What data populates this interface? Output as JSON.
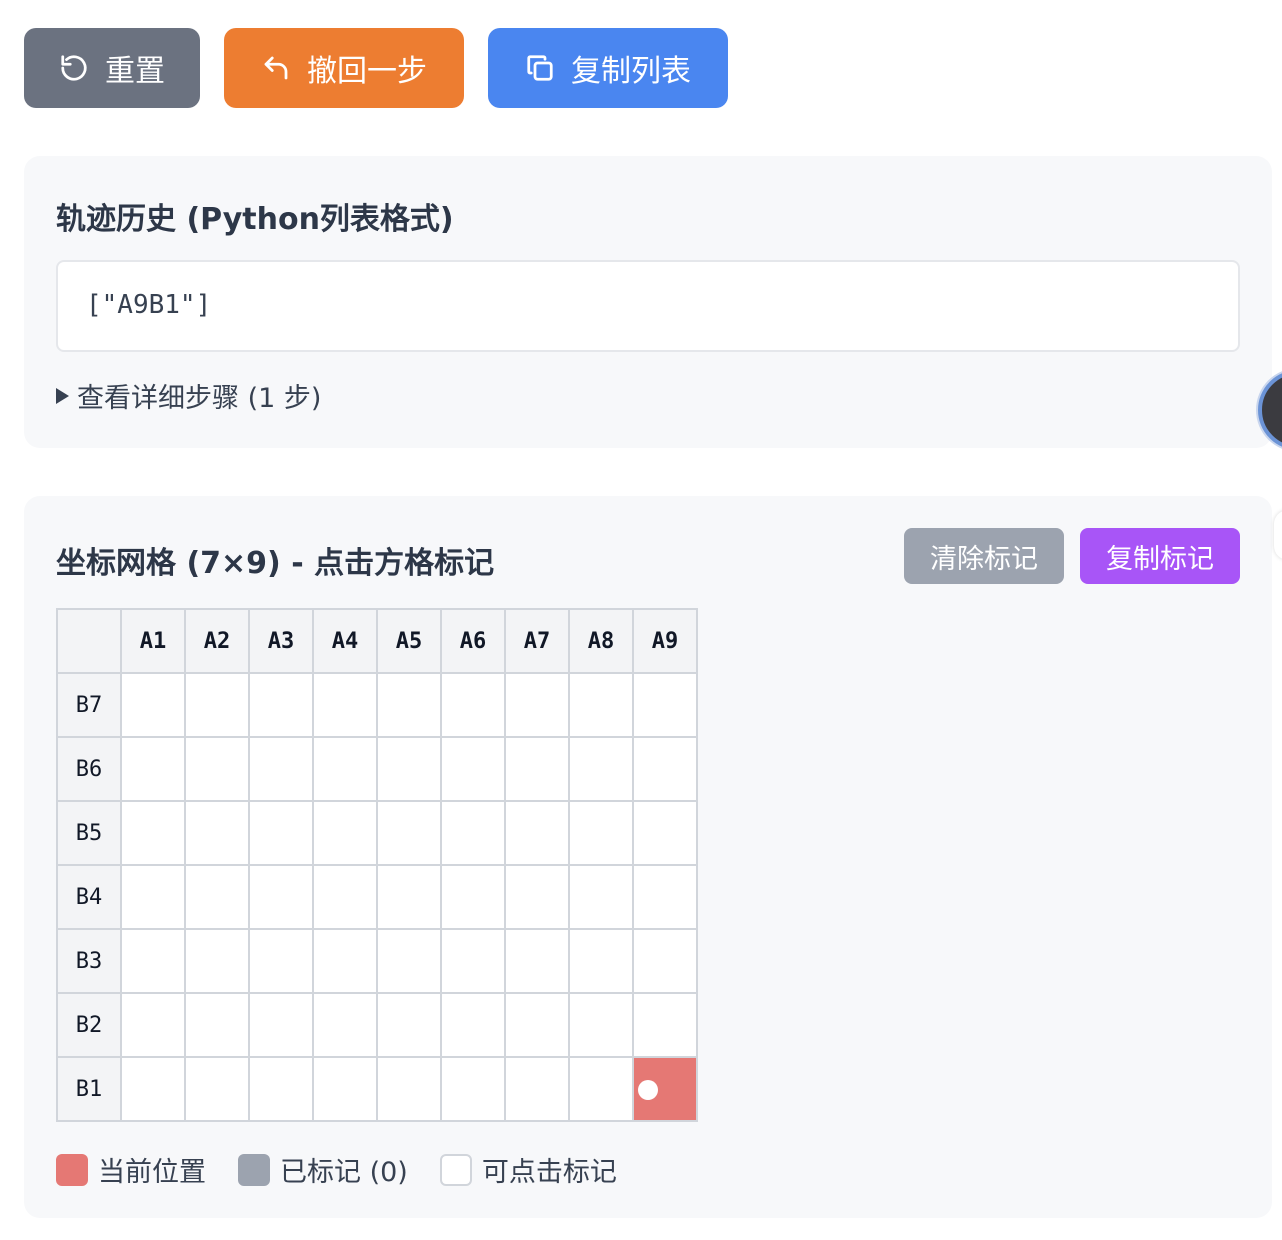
{
  "toolbar": {
    "reset_label": "重置",
    "undo_label": "撤回一步",
    "copy_label": "复制列表",
    "reset_color": "#6b7280",
    "undo_color": "#ed7d31",
    "copy_color": "#4a86f0"
  },
  "history": {
    "title": "轨迹历史 (Python列表格式)",
    "code": "[\"A9B1\"]",
    "details_label": "查看详细步骤 (1 步)"
  },
  "grid_panel": {
    "title": "坐标网格 (7×9) - 点击方格标记",
    "clear_label": "清除标记",
    "copy_marks_label": "复制标记",
    "columns": [
      "A1",
      "A2",
      "A3",
      "A4",
      "A5",
      "A6",
      "A7",
      "A8",
      "A9"
    ],
    "rows": [
      "B7",
      "B6",
      "B5",
      "B4",
      "B3",
      "B2",
      "B1"
    ],
    "current_position": "A9B1",
    "current_color": "#e57874"
  },
  "legend": {
    "current": "当前位置",
    "marked": "已标记 (0)",
    "clickable": "可点击标记"
  }
}
